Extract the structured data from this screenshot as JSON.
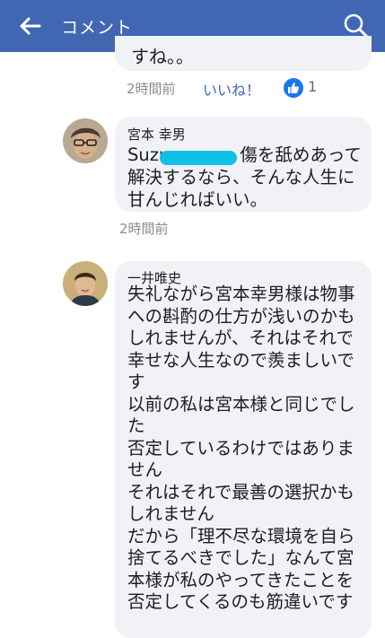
{
  "header": {
    "title": "コメント",
    "back_icon": "arrow-left-icon",
    "search_icon": "search-icon",
    "bar_color": "#4267b2"
  },
  "previous_comment": {
    "tail_text": "すね。。",
    "time": "2時間前",
    "like_label": "いいね！",
    "like_count": "1"
  },
  "comments": [
    {
      "author": "宮本 幸男",
      "line1_prefix": "Suzu",
      "line1_suffix": "傷を舐めあって",
      "rest": "解決するなら、そんな人生に\n甘んじればいい。",
      "time": "2時間前"
    },
    {
      "author": "一井唯史",
      "text": "失礼ながら宮本幸男様は物事\nへの斟酌の仕方が浅いのかも\nしれませんが、それはそれで\n幸せな人生なので羨ましいで\nす\n以前の私は宮本様と同じでし\nた\n否定しているわけではありま\nせん\nそれはそれで最善の選択かも\nしれません\nだから「理不尽な環境を自ら\n捨てるべきでした」なんて宮\n本様が私のやってきたことを\n否定してくるのも筋違いです"
    }
  ]
}
